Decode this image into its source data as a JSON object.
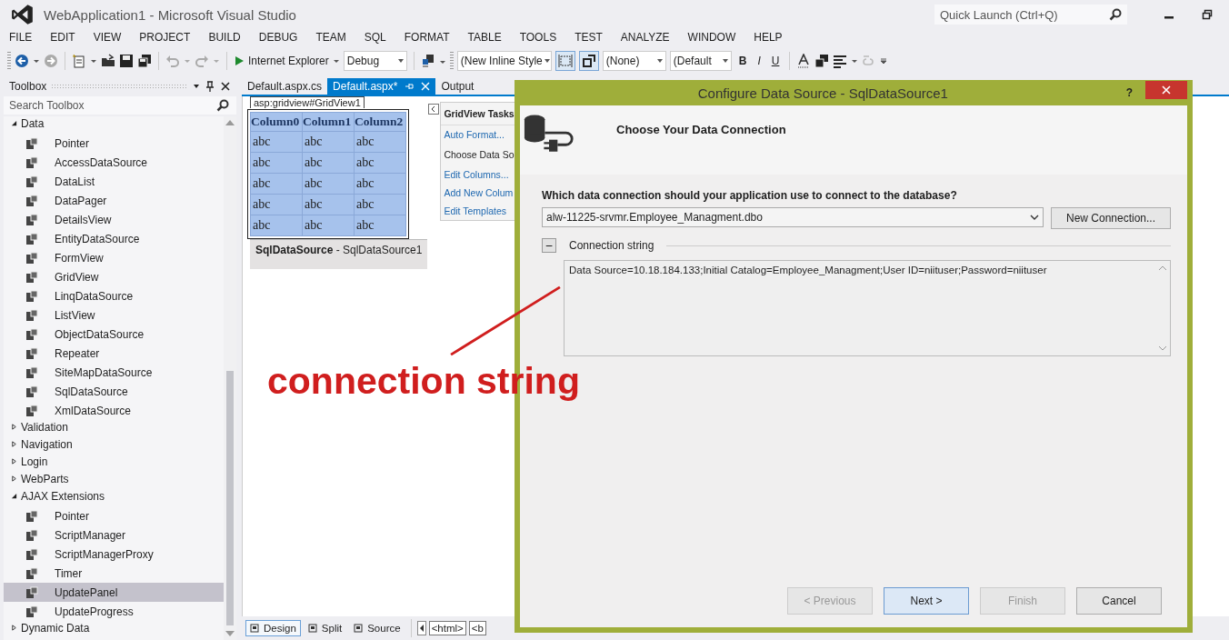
{
  "window": {
    "title": "WebApplication1 - Microsoft Visual Studio",
    "quick_launch": {
      "placeholder": "Quick Launch (Ctrl+Q)"
    }
  },
  "menu": [
    "FILE",
    "EDIT",
    "VIEW",
    "PROJECT",
    "BUILD",
    "DEBUG",
    "TEAM",
    "SQL",
    "FORMAT",
    "TABLE",
    "TOOLS",
    "TEST",
    "ANALYZE",
    "WINDOW",
    "HELP"
  ],
  "toolbar": {
    "run_target": "Internet Explorer",
    "configuration": "Debug",
    "style": "(New Inline Style",
    "target_rule": "(None)",
    "font": "(Default",
    "format_buttons": [
      "B",
      "I",
      "U"
    ]
  },
  "toolbox": {
    "title": "Toolbox",
    "search": {
      "placeholder": "Search Toolbox"
    },
    "categories": [
      {
        "label": "Data",
        "expanded": true,
        "children": [
          {
            "label": "Pointer",
            "selected": false
          },
          {
            "label": "AccessDataSource",
            "selected": false
          },
          {
            "label": "DataList",
            "selected": false
          },
          {
            "label": "DataPager",
            "selected": false
          },
          {
            "label": "DetailsView",
            "selected": false
          },
          {
            "label": "EntityDataSource",
            "selected": false
          },
          {
            "label": "FormView",
            "selected": false
          },
          {
            "label": "GridView",
            "selected": false
          },
          {
            "label": "LinqDataSource",
            "selected": false
          },
          {
            "label": "ListView",
            "selected": false
          },
          {
            "label": "ObjectDataSource",
            "selected": false
          },
          {
            "label": "Repeater",
            "selected": false
          },
          {
            "label": "SiteMapDataSource",
            "selected": false
          },
          {
            "label": "SqlDataSource",
            "selected": false
          },
          {
            "label": "XmlDataSource",
            "selected": false
          }
        ]
      },
      {
        "label": "Validation",
        "expanded": false
      },
      {
        "label": "Navigation",
        "expanded": false
      },
      {
        "label": "Login",
        "expanded": false
      },
      {
        "label": "WebParts",
        "expanded": false
      },
      {
        "label": "AJAX Extensions",
        "expanded": true,
        "children": [
          {
            "label": "Pointer",
            "selected": false
          },
          {
            "label": "ScriptManager",
            "selected": false
          },
          {
            "label": "ScriptManagerProxy",
            "selected": false
          },
          {
            "label": "Timer",
            "selected": false
          },
          {
            "label": "UpdatePanel",
            "selected": true
          },
          {
            "label": "UpdateProgress",
            "selected": false
          }
        ]
      },
      {
        "label": "Dynamic Data",
        "expanded": false
      }
    ]
  },
  "editor": {
    "tabs": [
      {
        "label": "Default.aspx.cs",
        "selected": false
      },
      {
        "label": "Default.aspx*",
        "selected": true
      },
      {
        "label": "Output",
        "selected": false
      }
    ],
    "designer": {
      "element_tag": "asp:gridview#GridView1",
      "grid": {
        "columns": [
          "Column0",
          "Column1",
          "Column2"
        ],
        "rows": [
          [
            "abc",
            "abc",
            "abc"
          ],
          [
            "abc",
            "abc",
            "abc"
          ],
          [
            "abc",
            "abc",
            "abc"
          ],
          [
            "abc",
            "abc",
            "abc"
          ],
          [
            "abc",
            "abc",
            "abc"
          ]
        ]
      },
      "smart_tag": {
        "title": "GridView Tasks",
        "items": [
          {
            "label": "Auto Format...",
            "kind": "link"
          },
          {
            "label": "Choose Data So",
            "kind": "label"
          },
          {
            "label": "Edit Columns...",
            "kind": "link"
          },
          {
            "label": "Add New Colum",
            "kind": "link"
          },
          {
            "label": "Edit Templates",
            "kind": "link"
          }
        ]
      },
      "data_source": "**SqlDataSource** - SqlDataSource1"
    },
    "view_tabs": [
      {
        "label": "Design",
        "selected": true
      },
      {
        "label": "Split",
        "selected": false
      },
      {
        "label": "Source",
        "selected": false
      }
    ],
    "breadcrumbs": [
      "<html>",
      "<b"
    ]
  },
  "dialog": {
    "title": "Configure Data Source - SqlDataSource1",
    "help": "?",
    "heading": "Choose Your Data Connection",
    "question": "Which data connection should your application use to connect to the database?",
    "connection": "alw-11225-srvmr.Employee_Managment.dbo",
    "new_connection": "New Connection...",
    "connection_string": {
      "toggle": "–",
      "label": "Connection string",
      "expanded": true,
      "value": "Data Source=10.18.184.133;Initial Catalog=Employee_Managment;User ID=niituser;Password=niituser"
    },
    "buttons": [
      {
        "label": "< Previous",
        "disabled": true,
        "default": false
      },
      {
        "label": "Next >",
        "disabled": false,
        "default": true
      },
      {
        "label": "Finish",
        "disabled": true,
        "default": false
      },
      {
        "label": "Cancel",
        "disabled": false,
        "default": false
      }
    ]
  },
  "annotation": {
    "text": "connection string"
  }
}
